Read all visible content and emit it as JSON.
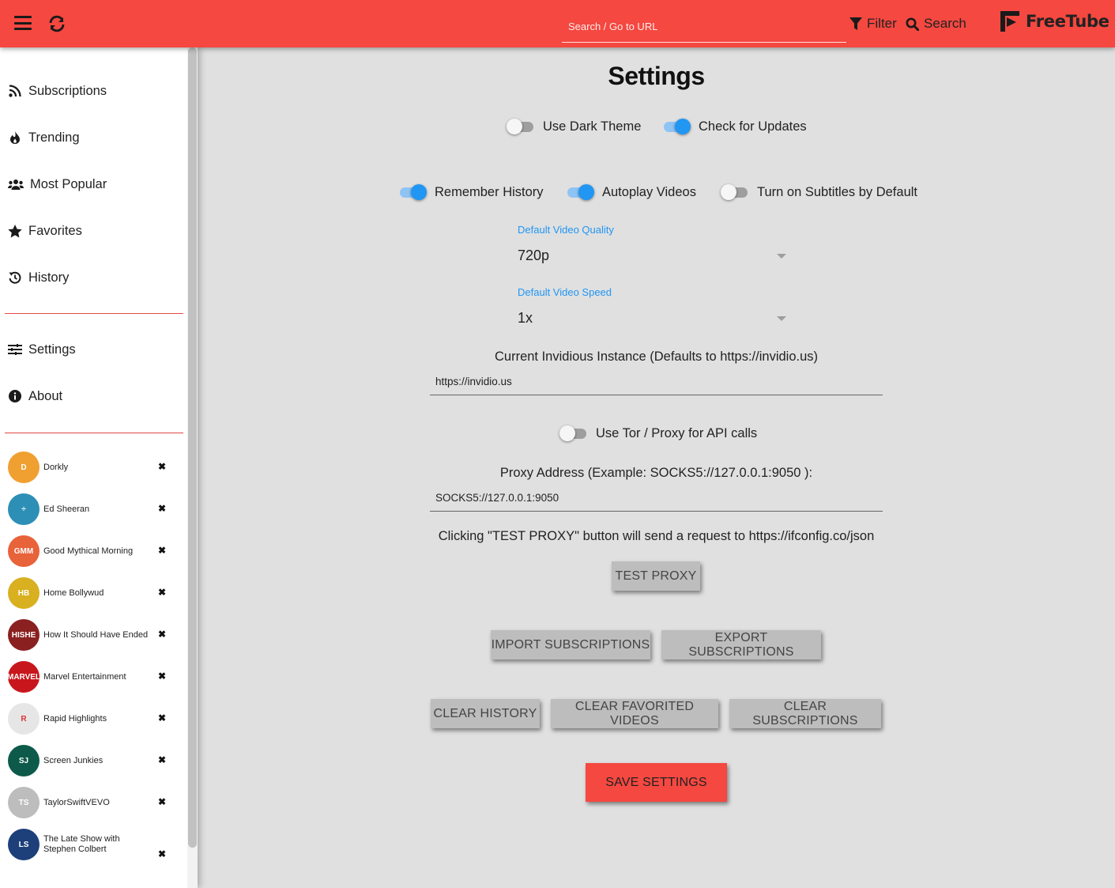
{
  "header": {
    "search_placeholder": "Search / Go to URL",
    "filter_label": "Filter",
    "search_label": "Search",
    "logo_text": "FreeTube",
    "colors": {
      "bar": "#f44840",
      "accent": "#2196f3"
    }
  },
  "sidebar": {
    "nav": [
      {
        "label": "Subscriptions",
        "icon": "rss-icon"
      },
      {
        "label": "Trending",
        "icon": "fire-icon"
      },
      {
        "label": "Most Popular",
        "icon": "users-icon"
      },
      {
        "label": "Favorites",
        "icon": "star-icon"
      },
      {
        "label": "History",
        "icon": "history-icon"
      }
    ],
    "nav2": [
      {
        "label": "Settings",
        "icon": "sliders-icon"
      },
      {
        "label": "About",
        "icon": "info-icon"
      }
    ],
    "subscriptions": [
      {
        "name": "Dorkly",
        "avatar_color": "#f0a030",
        "avatar_text": "D"
      },
      {
        "name": "Ed Sheeran",
        "avatar_color": "#2d8fb5",
        "avatar_text": "÷"
      },
      {
        "name": "Good Mythical Morning",
        "avatar_color": "#e8623a",
        "avatar_text": "GMM"
      },
      {
        "name": "Home Bollywud",
        "avatar_color": "#d8b020",
        "avatar_text": "HB"
      },
      {
        "name": "How It Should Have Ended",
        "avatar_color": "#8a2020",
        "avatar_text": "HISHE"
      },
      {
        "name": "Marvel Entertainment",
        "avatar_color": "#c8161d",
        "avatar_text": "MARVEL"
      },
      {
        "name": "Rapid Highlights",
        "avatar_color": "#e6e6e6",
        "avatar_text": "R"
      },
      {
        "name": "Screen Junkies",
        "avatar_color": "#0d5a4a",
        "avatar_text": "SJ"
      },
      {
        "name": "TaylorSwiftVEVO",
        "avatar_color": "#bdbdbd",
        "avatar_text": "TS"
      },
      {
        "name": "The Late Show with Stephen Colbert",
        "avatar_color": "#1d3f7a",
        "avatar_text": "LS"
      }
    ],
    "remove_glyph": "✖"
  },
  "settings": {
    "title": "Settings",
    "dark_theme": {
      "label": "Use Dark Theme",
      "on": false
    },
    "check_updates": {
      "label": "Check for Updates",
      "on": true
    },
    "remember_history": {
      "label": "Remember History",
      "on": true
    },
    "autoplay": {
      "label": "Autoplay Videos",
      "on": true
    },
    "subtitles": {
      "label": "Turn on Subtitles by Default",
      "on": false
    },
    "quality": {
      "label": "Default Video Quality",
      "value": "720p"
    },
    "speed": {
      "label": "Default Video Speed",
      "value": "1x"
    },
    "instance": {
      "label": "Current Invidious Instance (Defaults to https://invidio.us)",
      "value": "https://invidio.us"
    },
    "tor": {
      "label": "Use Tor / Proxy for API calls",
      "on": false
    },
    "proxy": {
      "label": "Proxy Address (Example: SOCKS5://127.0.0.1:9050 ):",
      "value": "SOCKS5://127.0.0.1:9050"
    },
    "proxy_note": "Clicking \"TEST PROXY\" button will send a request to https://ifconfig.co/json",
    "buttons": {
      "test_proxy": "TEST PROXY",
      "import_subs": "IMPORT SUBSCRIPTIONS",
      "export_subs": "EXPORT SUBSCRIPTIONS",
      "clear_history": "CLEAR HISTORY",
      "clear_favorites": "CLEAR FAVORITED VIDEOS",
      "clear_subs": "CLEAR SUBSCRIPTIONS",
      "save": "SAVE SETTINGS"
    }
  }
}
